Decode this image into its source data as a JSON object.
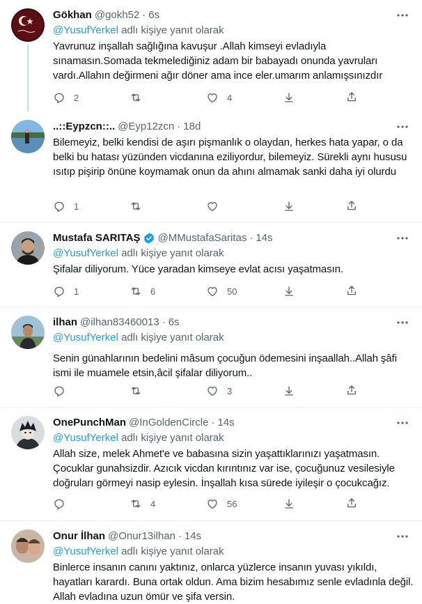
{
  "reply_prefix": "adlı kişiye yanıt olarak",
  "tweets": [
    {
      "name": "Gökhan",
      "handle": "@gokh52",
      "dot": "·",
      "time": "6s",
      "reply_mention": "@YusufYerkel",
      "text": "Yavrunuz inşallah sağlığına kavuşur .Allah kimseyi evladıyla sınamasın.Somada tekmelediğiniz adam bir babayadı onunda yavruları vardı.Allahın değirmeni ağır döner ama ince eler.umarım anlamışsınızdır",
      "replies": "2",
      "retweets": "",
      "likes": "4",
      "verified": false,
      "avatar": "turkish-flag-avatar"
    },
    {
      "name": "..::Eypzcn::..",
      "handle": "@Eyp12zcn",
      "dot": "·",
      "time": "18d",
      "reply_mention": "",
      "text": "Bilemeyiz, belki kendisi de aşırı pişmanlık o olaydan, herkes hata yapar, o da belki bu hatası yüzünden vicdanına eziliyordur, bilemeyiz. Sürekli aynı hususu ısıtıp pişirip önüne koymamak onun da ahını almamak sanki daha iyi olurdu",
      "replies": "1",
      "retweets": "",
      "likes": "",
      "verified": false,
      "avatar": "lake-photo-avatar"
    },
    {
      "name": "Mustafa SARITAŞ",
      "handle": "@MMustafaSaritas",
      "dot": "·",
      "time": "14s",
      "reply_mention": "@YusufYerkel",
      "text": "Şifalar diliyorum. Yüce yaradan kimseye evlat acısı yaşatmasın.",
      "replies": "1",
      "retweets": "6",
      "likes": "50",
      "verified": true,
      "avatar": "bearded-man-avatar"
    },
    {
      "name": "ilhan",
      "handle": "@ilhan83460013",
      "dot": "·",
      "time": "6s",
      "reply_mention": "@YusufYerkel",
      "text": "Senin günahlarının bedelini mâsum çocuğun ödemesini inşaallah..Allah şâfi ismi ile muamele etsin,âcil şifalar diliyorum..",
      "replies": "",
      "retweets": "",
      "likes": "3",
      "verified": false,
      "avatar": "man-outdoors-avatar"
    },
    {
      "name": "OnePunchMan",
      "handle": "@InGoldenCircle",
      "dot": "·",
      "time": "14s",
      "reply_mention": "@YusufYerkel",
      "text": "Allah size, melek Ahmet'e ve babasına sizin yaşattıklarınızı yaşatmasın. Çocuklar gunahsizdir. Azıcık vicdan kırıntınız var ise, çocuğunuz vesilesiyle doğruları görmeyi nasip eylesin. İnşallah kısa sürede iyileşir o çocukcağız.",
      "replies": "",
      "retweets": "4",
      "likes": "56",
      "verified": false,
      "avatar": "anime-character-avatar"
    },
    {
      "name": "Onur İlhan",
      "handle": "@Onur13ilhan",
      "dot": "·",
      "time": "14s",
      "reply_mention": "@YusufYerkel",
      "text": "Binlerce insanın canını yaktınız, onlarca yüzlerce insanın yuvası yıkıldı, hayatları karardı. Buna ortak oldun. Ama bizim hesabımız senle evladınla değil. Allah evladına uzun ömür ve şifa versin.",
      "replies": "",
      "retweets": "",
      "likes": "",
      "verified": false,
      "avatar": "two-people-avatar"
    }
  ]
}
